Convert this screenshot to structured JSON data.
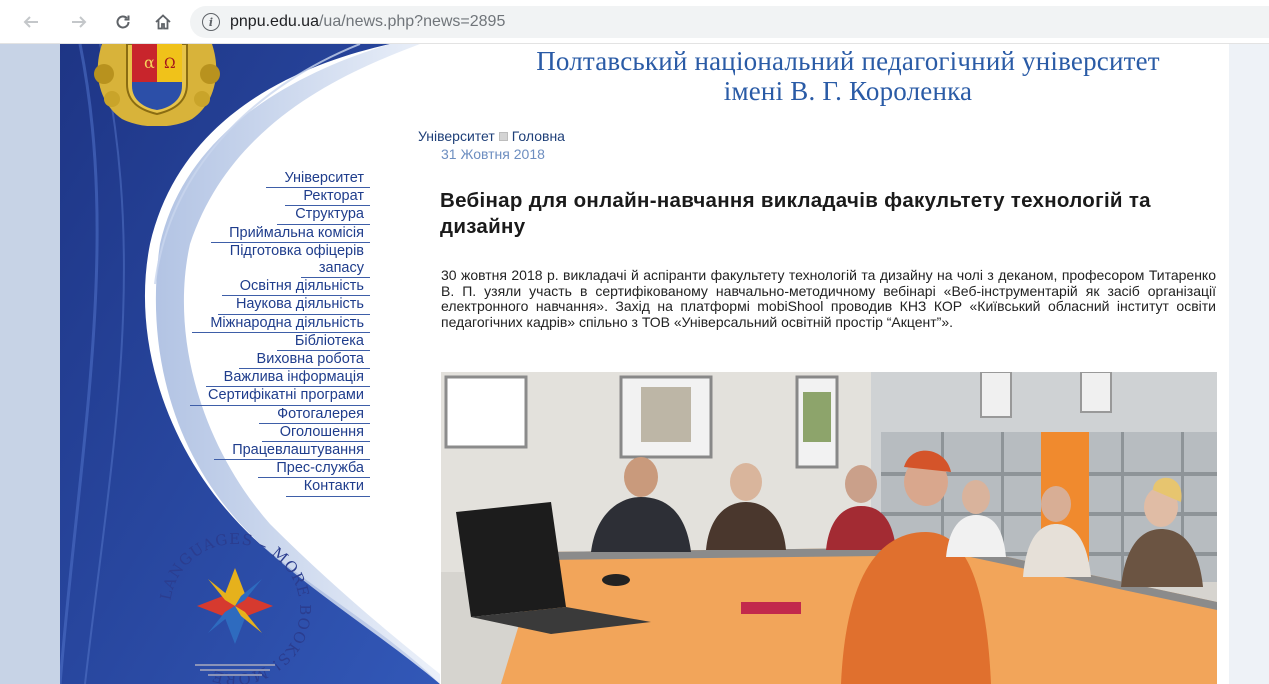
{
  "browser": {
    "url_domain": "pnpu.edu.ua",
    "url_path": "/ua/news.php?news=2895"
  },
  "site": {
    "title_line1": "Полтавський національний педагогічний університет",
    "title_line2": "імені В. Г. Короленка"
  },
  "breadcrumb": {
    "item1": "Університет",
    "item2": "Головна"
  },
  "article": {
    "date": "31 Жовтня 2018",
    "title": "Вебінар для онлайн-навчання викладачів факультету технологій та дизайну",
    "body": "30 жовтня 2018 р. викладачі й аспіранти факультету технологій та дизайну на чолі з деканом, професором Титаренко В. П. узяли участь в сертифікованому навчально-методичному вебінарі «Веб-інструментарій як засіб організації електронного навчання». Захід на платформі mobiShool  проводив КНЗ КОР «Київський обласний інститут освіти педагогічних кадрів» спільно з ТОВ «Універсальний освітній простір “Акцент”»."
  },
  "menu": [
    {
      "label": "Університет"
    },
    {
      "label": "Ректорат"
    },
    {
      "label": "Структура"
    },
    {
      "label": "Приймальна комісія"
    },
    {
      "label": "Підготовка офіцерів"
    },
    {
      "label": "запасу"
    },
    {
      "label": "Освітня діяльність"
    },
    {
      "label": "Наукова діяльність"
    },
    {
      "label": "Міжнародна діяльність"
    },
    {
      "label": "Бібліотека"
    },
    {
      "label": "Виховна робота"
    },
    {
      "label": "Важлива інформація"
    },
    {
      "label": "Сертифікатні програми"
    },
    {
      "label": "Фотогалерея"
    },
    {
      "label": "Оголошення"
    },
    {
      "label": "Працевлаштування"
    },
    {
      "label": "Прес-служба"
    },
    {
      "label": "Контакти"
    }
  ],
  "logo": {
    "text": "LANGUAGES – MORE BOOKS! MORE"
  },
  "colors": {
    "title_blue": "#2a5ba6",
    "menu_blue": "#1f3d8c",
    "date_blue": "#6d8ec0",
    "art_dark_blue": "#1f3a8a"
  },
  "icons": {
    "back": "back-arrow-icon",
    "forward": "forward-arrow-icon",
    "reload": "reload-icon",
    "home": "home-icon",
    "info": "info-icon"
  }
}
